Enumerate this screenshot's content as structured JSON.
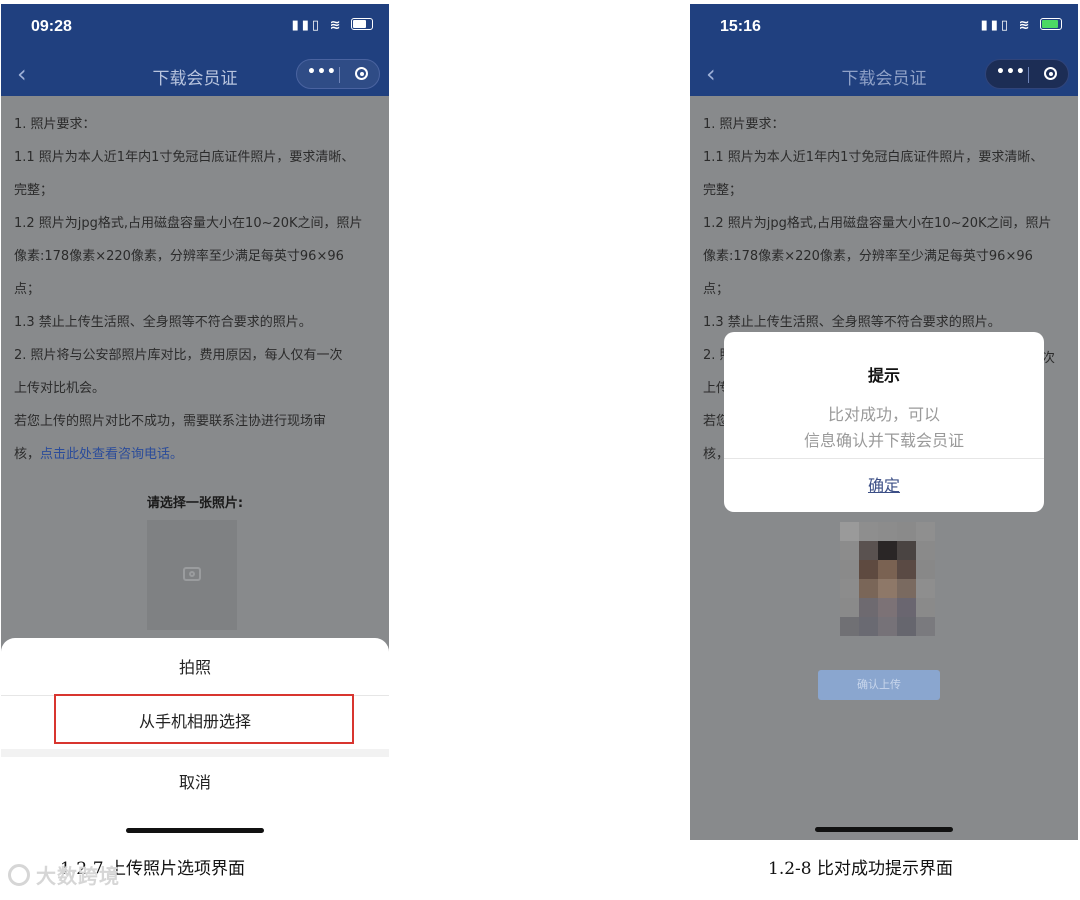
{
  "left_screen": {
    "status": {
      "time": "09:28",
      "signal_wifi": "⁙ ▽"
    },
    "nav": {
      "back": "‹",
      "title": "下载会员证",
      "more": "•••"
    },
    "requirements": [
      "1. 照片要求：",
      "1.1 照片为本人近1年内1寸免冠白底证件照片，要求清晰、",
      "完整；",
      "1.2 照片为jpg格式,占用磁盘容量大小在10~20K之间，照片",
      "像素:178像素×220像素，分辨率至少满足每英寸96×96",
      "点；",
      "1.3 禁止上传生活照、全身照等不符合要求的照片。",
      "2. 照片将与公安部照片库对比，费用原因，每人仅有一次",
      "上传对比机会。",
      "若您上传的照片对比不成功，需要联系注协进行现场审"
    ],
    "last_line_prefix": "核，",
    "phone_link": "点击此处查看咨询电话。",
    "choose_label": "请选择一张照片:",
    "sheet": {
      "take_photo": "拍照",
      "from_album": "从手机相册选择",
      "cancel": "取消"
    },
    "caption": "1.2-7  上传照片选项界面"
  },
  "right_screen": {
    "status": {
      "time": "15:16"
    },
    "nav": {
      "back": "‹",
      "title": "下载会员证",
      "more": "•••"
    },
    "requirements_visible": [
      "1. 照片要求：",
      "1.1 照片为本人近1年内1寸免冠白底证件照片，要求清晰、",
      "完整；",
      "1.2 照片为jpg格式,占用磁盘容量大小在10~20K之间，照片",
      "像素:178像素×220像素，分辨率至少满足每英寸96×96",
      "点；",
      "1.3 禁止上传生活照、全身照等不符合要求的照片。"
    ],
    "partial_left": [
      "2. 照",
      "上传",
      "若您",
      "核，"
    ],
    "partial_right": "次",
    "dialog": {
      "title": "提示",
      "message_line1": "比对成功，可以",
      "message_line2": "信息确认并下载会员证",
      "confirm": "确定"
    },
    "upload_button": "确认上传",
    "caption": "1.2-8  比对成功提示界面"
  },
  "watermark": "大数跨境",
  "colors": {
    "nav_blue": "#20407f",
    "overlay_gray": "#888a8c",
    "highlight_red": "#d8352f",
    "link_blue": "#2b4c9a"
  }
}
